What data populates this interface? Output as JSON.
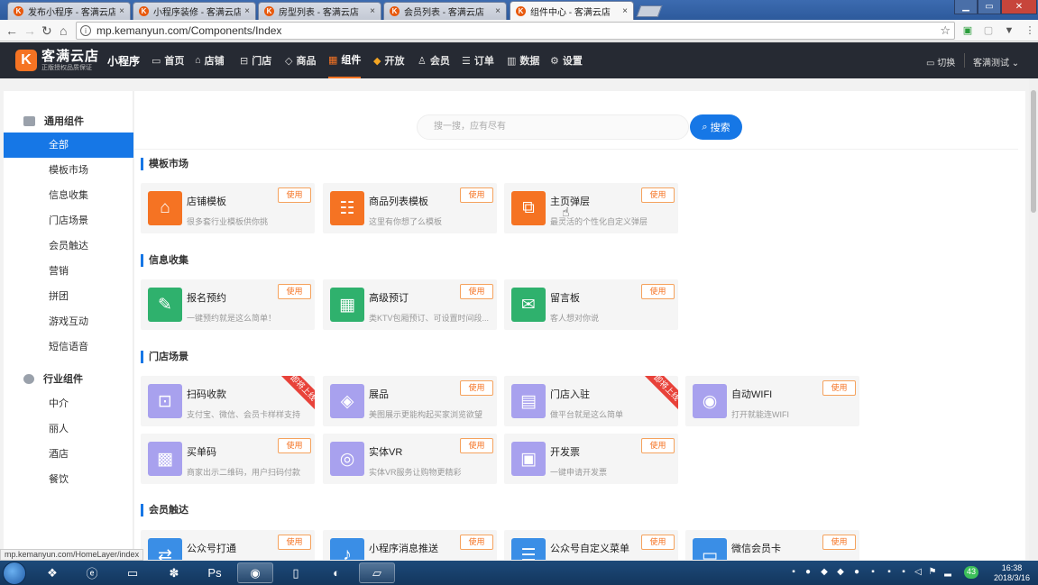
{
  "browser": {
    "tabs": [
      {
        "label": "发布小程序 - 客满云店",
        "favicon": "K"
      },
      {
        "label": "小程序装修 - 客满云店",
        "favicon": "K"
      },
      {
        "label": "房型列表 - 客满云店",
        "favicon": "K"
      },
      {
        "label": "会员列表 - 客满云店",
        "favicon": "K"
      },
      {
        "label": "组件中心 - 客满云店",
        "favicon": "K"
      }
    ],
    "close_glyph": "×",
    "url": "mp.kemanyun.com/Components/Index",
    "status_url": "mp.kemanyun.com/HomeLayer/index"
  },
  "header": {
    "logo_mark": "K",
    "logo_name": "客满云店",
    "logo_sub": "正版授权品质保证",
    "product": "小程序",
    "nav": [
      {
        "label": "首页",
        "icon": "message-icon"
      },
      {
        "label": "店铺",
        "icon": "home-icon"
      },
      {
        "label": "门店",
        "icon": "store-icon"
      },
      {
        "label": "商品",
        "icon": "tag-icon"
      },
      {
        "label": "组件",
        "icon": "grid-icon"
      },
      {
        "label": "开放",
        "icon": "cube-icon"
      },
      {
        "label": "会员",
        "icon": "user-icon"
      },
      {
        "label": "订单",
        "icon": "order-icon"
      },
      {
        "label": "数据",
        "icon": "chart-icon"
      },
      {
        "label": "设置",
        "icon": "gear-icon"
      }
    ],
    "active_nav": "组件",
    "switch_label": "切换",
    "account_label": "客满测试"
  },
  "sidebar": {
    "group1": "通用组件",
    "group1_items": [
      "全部",
      "模板市场",
      "信息收集",
      "门店场景",
      "会员触达",
      "营销",
      "拼团",
      "游戏互动",
      "短信语音"
    ],
    "group2": "行业组件",
    "group2_items": [
      "中介",
      "丽人",
      "酒店",
      "餐饮"
    ]
  },
  "search": {
    "placeholder": "搜一搜，应有尽有",
    "button": "搜索"
  },
  "use_label": "使用",
  "ribbon_label": "即将上线",
  "sections": [
    {
      "title": "模板市场",
      "cards": [
        {
          "name": "店铺模板",
          "desc": "很多套行业模板供你挑"
        },
        {
          "name": "商品列表模板",
          "desc": "这里有你想了么模板"
        },
        {
          "name": "主页弹层",
          "desc": "最灵活的个性化自定义弹层"
        }
      ]
    },
    {
      "title": "信息收集",
      "cards": [
        {
          "name": "报名预约",
          "desc": "一键预约就是这么简单！"
        },
        {
          "name": "高级预订",
          "desc": "类KTV包厢预订、可设置时间段..."
        },
        {
          "name": "留言板",
          "desc": "客人想对你说"
        }
      ]
    },
    {
      "title": "门店场景",
      "cards": [
        {
          "name": "扫码收款",
          "desc": "支付宝、微信、会员卡样样支持"
        },
        {
          "name": "展品",
          "desc": "美图展示更能构起买家浏览欲望"
        },
        {
          "name": "门店入驻",
          "desc": "做平台就是这么简单"
        },
        {
          "name": "自动WIFI",
          "desc": "打开就能连WIFI"
        },
        {
          "name": "买单码",
          "desc": "商家出示二维码，用户扫码付款"
        },
        {
          "name": "实体VR",
          "desc": "实体VR服务让购物更精彩"
        },
        {
          "name": "开发票",
          "desc": "一键申请开发票"
        }
      ]
    },
    {
      "title": "会员触达",
      "cards": [
        {
          "name": "公众号打通",
          "desc": ""
        },
        {
          "name": "小程序消息推送",
          "desc": ""
        },
        {
          "name": "公众号自定义菜单",
          "desc": ""
        },
        {
          "name": "微信会员卡",
          "desc": ""
        }
      ]
    }
  ],
  "taskbar": {
    "time": "16:38",
    "date": "2018/3/16",
    "badge": "43"
  },
  "colors": {
    "brand_orange": "#f57323",
    "primary_blue": "#1677e6",
    "header_dark": "#262a33"
  }
}
